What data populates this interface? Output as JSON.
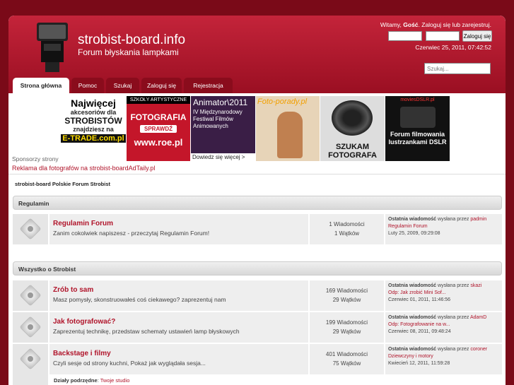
{
  "header": {
    "site_title": "strobist-board.info",
    "site_subtitle": "Forum błyskania lampkami",
    "welcome_prefix": "Witamy,",
    "welcome_user": "Gość",
    "welcome_suffix": ". Zaloguj się lub zarejestruj.",
    "login_button": "Zaloguj się",
    "datetime": "Czerwiec 25, 2011, 07:42:52",
    "search_placeholder": "Szukaj..."
  },
  "tabs": [
    "Strona główna",
    "Pomoc",
    "Szukaj",
    "Zaloguj się",
    "Rejestracja"
  ],
  "ads": {
    "b1": [
      "Najwięcej",
      "akcesoriów dla",
      "STROBISTÓW",
      "znajdziesz na",
      "E-TRADE.com.pl"
    ],
    "b2": [
      "SZKOŁY ARTYSTYCZNE",
      "FOTOGRAFIA",
      "SPRAWDŹ",
      "www.roe.pl"
    ],
    "b3": [
      "Animator\\2011",
      "IV Międzynarodowy Festiwal Filmów Animowanych",
      "Dowiedz się więcej >"
    ],
    "b4": [
      "Foto-porady.pl"
    ],
    "b5": [
      "SZUKAM",
      "FOTOGRAFA"
    ],
    "b6": [
      "moviesDSLR.pl",
      "Forum filmowania",
      "lustrzankami DSLR"
    ],
    "sponsors_label": "Sponsorzy strony",
    "reklama": "Reklama dla fotografów na strobist-boardAdTaily.pl"
  },
  "breadcrumb": "strobist-board Polskie Forum Strobist",
  "categories": [
    {
      "name": "Regulamin",
      "forums": [
        {
          "title": "Regulamin Forum",
          "desc": "Zanim cokolwiek napiszesz - przeczytaj Regulamin Forum!",
          "posts": "1 Wiadomości",
          "topics": "1 Wątków",
          "last_prefix": "Ostatnia wiadomość",
          "last_by": "wysłana przez",
          "last_user": "padmin",
          "last_topic": "Regulamin Forum",
          "last_date": "Luty 25, 2009, 09:29:08"
        }
      ]
    },
    {
      "name": "Wszystko o Strobist",
      "forums": [
        {
          "title": "Zrób to sam",
          "desc": "Masz pomysły, skonstruowałeś coś ciekawego? zaprezentuj nam",
          "posts": "169 Wiadomości",
          "topics": "29 Wątków",
          "last_prefix": "Ostatnia wiadomość",
          "last_by": "wysłana przez",
          "last_user": "skazi",
          "last_topic": "Odp: Jak zrobić Mini Sof...",
          "last_date": "Czerwiec 01, 2011, 11:46:56"
        },
        {
          "title": "Jak fotografować?",
          "desc": "Zaprezentuj technikę, przedstaw schematy ustawień lamp błyskowych",
          "posts": "199 Wiadomości",
          "topics": "29 Wątków",
          "last_prefix": "Ostatnia wiadomość",
          "last_by": "wysłana przez",
          "last_user": "AdamD",
          "last_topic": "Odp: Fotografowanie na w...",
          "last_date": "Czerwiec 08, 2011, 09:48:24"
        },
        {
          "title": "Backstage i filmy",
          "desc": "Czyli sesje od strony kuchni, Pokaż jak wyglądała sesja...",
          "posts": "401 Wiadomości",
          "topics": "75 Wątków",
          "last_prefix": "Ostatnia wiadomość",
          "last_by": "wysłana przez",
          "last_user": "coroner",
          "last_topic": "Dziewczyny i motory",
          "last_date": "Kwiecień 12, 2011, 11:59:28"
        }
      ],
      "subforums_label": "Działy podrzędne",
      "subforum_link": "Twoje studio"
    }
  ]
}
